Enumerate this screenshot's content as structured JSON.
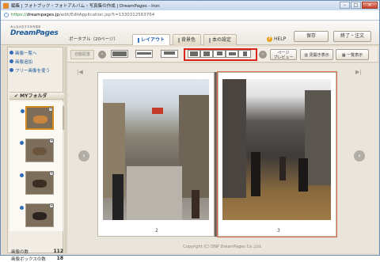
{
  "window": {
    "title": "編集 | フォトブック・フォトアルバム・写真集の作成 | DreamPages - Iron",
    "min": "–",
    "max": "□",
    "close": "×"
  },
  "address": {
    "scheme": "https://",
    "host": "dreampages.jp",
    "path": "/edit/EditApplication.jsp?t=1330312563764"
  },
  "header": {
    "logo_small": "みんなのおすすめ写真本",
    "logo": "DreamPages",
    "product": "ポータブル（20ページ）",
    "tabs": [
      {
        "label": "レイアウト",
        "active": true
      },
      {
        "label": "背景色",
        "active": false
      },
      {
        "label": "本の設定",
        "active": false
      }
    ],
    "help": "HELP",
    "save": "保存",
    "finish": "終了・注文"
  },
  "sidebar": {
    "items": [
      {
        "label": "画像一覧へ"
      },
      {
        "label": "画像追加"
      },
      {
        "label": "フリー画像を使う"
      }
    ],
    "folder": "MYフォルダ",
    "image_count_label": "画像の数",
    "image_count": "112",
    "box_count_label": "画像ボックスの数",
    "box_count": "18"
  },
  "toolbar": {
    "auto_layout": "自動配置",
    "page_preview_line1": "ページ",
    "page_preview_line2": "プレビュー",
    "spread_view": "見開き表示",
    "list_view": "一覧表示"
  },
  "stage": {
    "left_page_number": "2",
    "right_page_number": "3",
    "copyright": "Copyright (C) DNP DreamPages Co.,Ltd."
  }
}
